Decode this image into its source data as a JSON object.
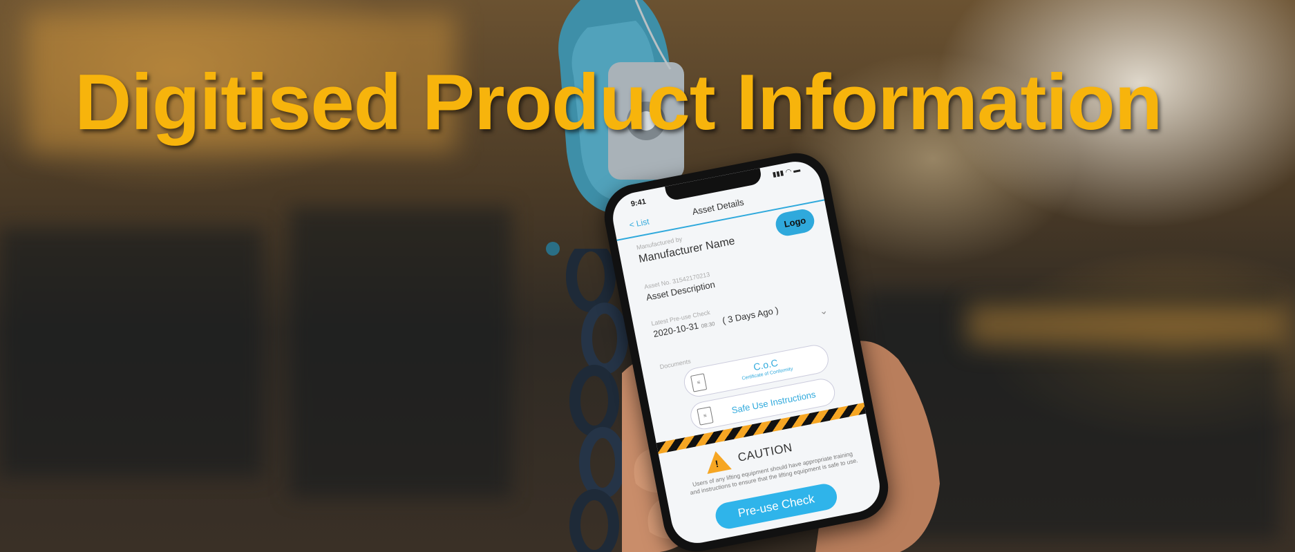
{
  "headline": "Digitised Product Information",
  "phone": {
    "status_time": "9:41",
    "status_icons": "▮▮▮ ◠ ▬",
    "back_label": "< List",
    "nav_title": "Asset Details",
    "logo_label": "Logo",
    "manufacturer_label": "Manufactured by",
    "manufacturer_name": "Manufacturer Name",
    "asset_no_label": "Asset No. 31542170213",
    "asset_description": "Asset Description",
    "check_label": "Latest Pre-use Check",
    "check_date": "2020-10-31",
    "check_time": "08:30",
    "check_ago": "( 3 Days Ago )",
    "documents_label": "Documents",
    "doc1_title": "C.o.C",
    "doc1_sub": "Certificate of Conformity",
    "doc2_title": "Safe Use Instructions",
    "caution_title": "CAUTION",
    "caution_text": "Users of any lifting equipment should have appropriate training and instructions to ensure that the lifting equipment is safe to use.",
    "preuse_button": "Pre-use Check"
  },
  "colors": {
    "headline": "#f7b40c",
    "accent": "#2fa9dc",
    "button": "#2fb4ea",
    "caution": "#f6a623",
    "hook": "#3e8fa8"
  }
}
